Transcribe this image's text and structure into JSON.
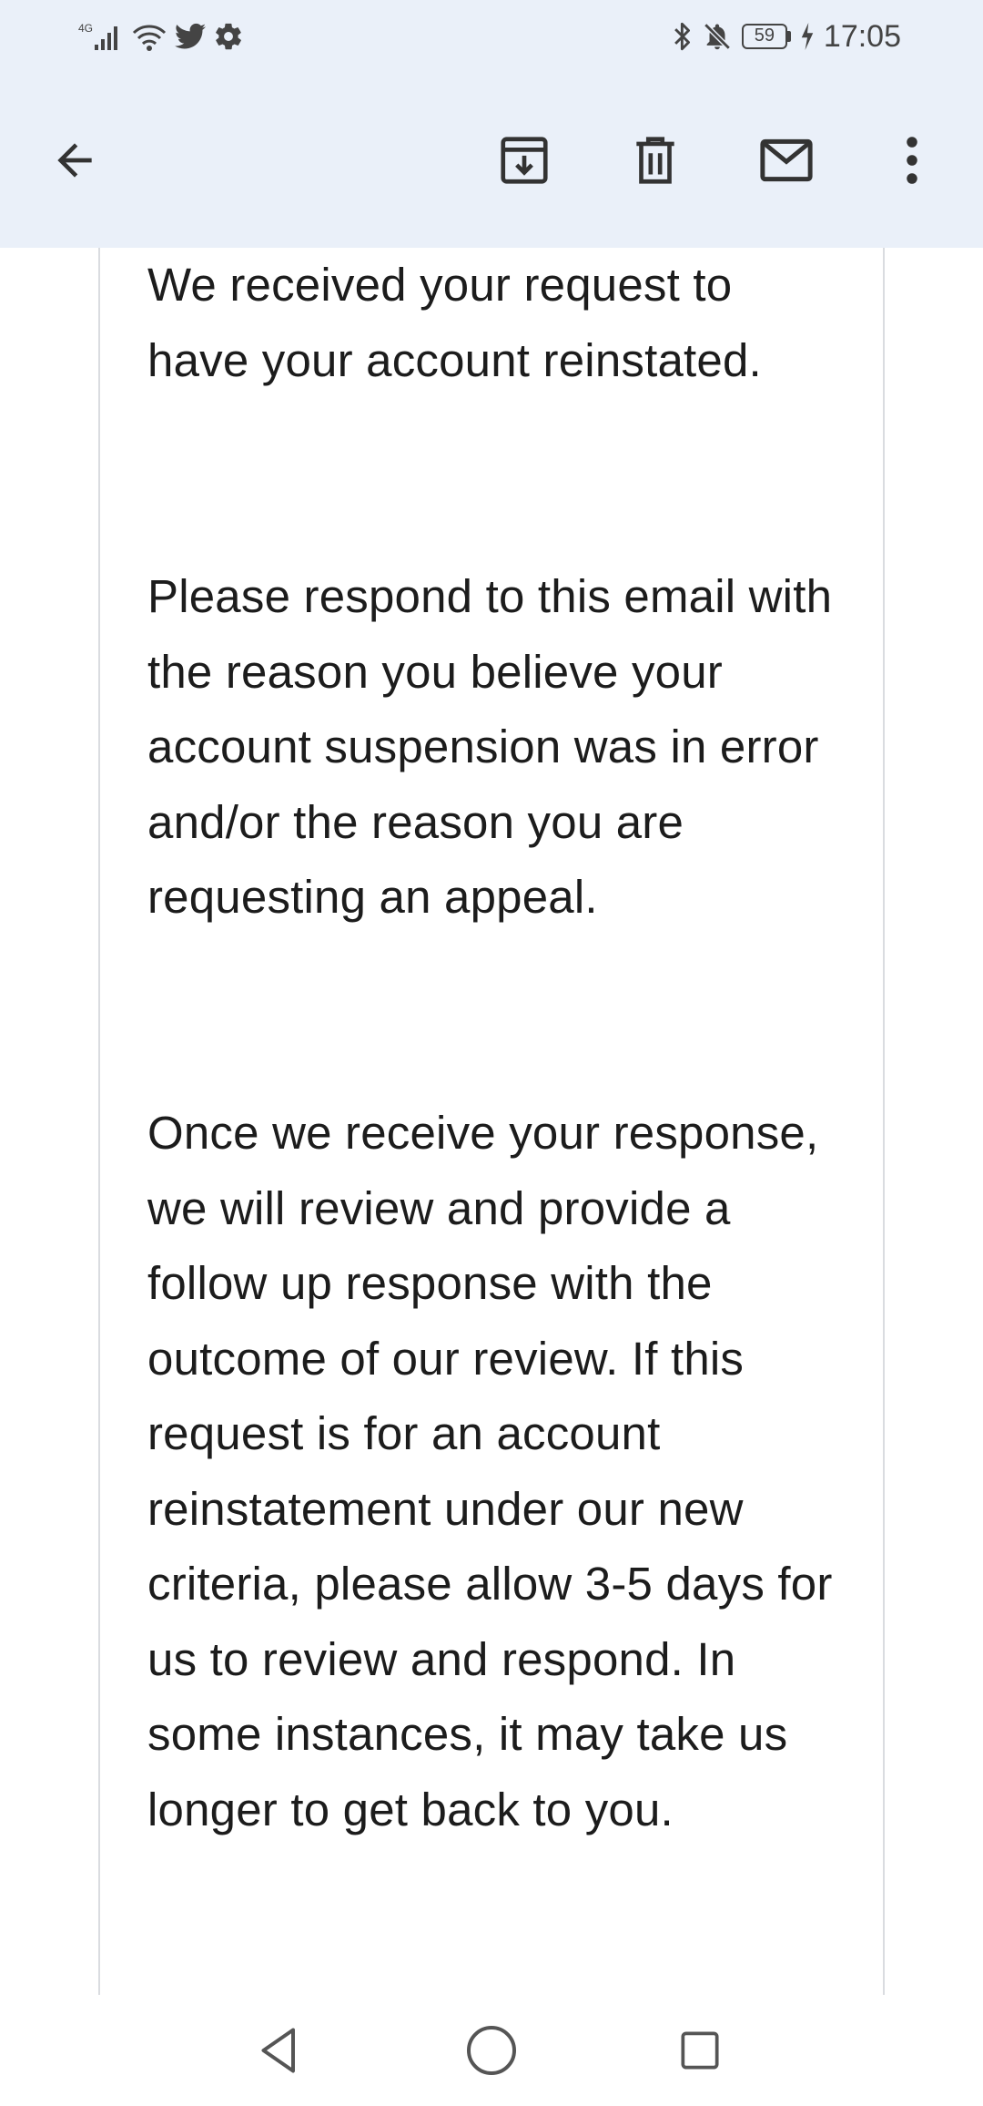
{
  "status_bar": {
    "network_label": "4G",
    "battery_level": "59",
    "time": "17:05",
    "left_icons": [
      "signal-icon",
      "wifi-icon",
      "twitter-icon",
      "settings-icon"
    ],
    "right_icons": [
      "bluetooth-icon",
      "mute-icon",
      "battery-icon",
      "charging-icon"
    ]
  },
  "toolbar": {
    "back": "back-arrow-icon",
    "actions": [
      "archive-icon",
      "delete-icon",
      "mark-unread-icon",
      "more-options-icon"
    ]
  },
  "email": {
    "paragraphs": [
      "We received your request to have your account reinstated.",
      "Please respond to this email with the reason you believe your account suspension was in error and/or the reason you are requesting an appeal.",
      "Once we receive your response, we will review and provide a follow up response with the outcome of our review. If this request is for an account reinstatement under our new criteria, please allow 3-5 days for us to review and respond. In some instances, it may take us longer to get back to you."
    ]
  },
  "nav_bar": {
    "buttons": [
      "nav-back-icon",
      "nav-home-icon",
      "nav-recents-icon"
    ]
  },
  "colors": {
    "header_background": "#eaf0f9",
    "icon_color": "#333333",
    "text_color": "#1c1c1c",
    "card_border": "#dadce0"
  }
}
